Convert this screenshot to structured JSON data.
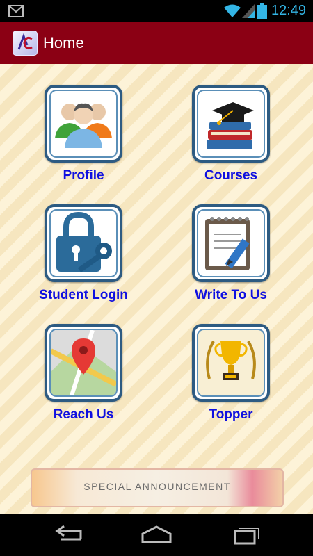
{
  "status_bar": {
    "time": "12:49",
    "icons": [
      "gmail-icon",
      "wifi-icon",
      "signal-icon",
      "battery-icon"
    ],
    "time_color": "#33b5e5"
  },
  "action_bar": {
    "title": "Home",
    "color": "#8b0014"
  },
  "tiles": [
    {
      "label": "Profile",
      "icon": "users-icon"
    },
    {
      "label": "Courses",
      "icon": "graduation-books-icon"
    },
    {
      "label": "Student Login",
      "icon": "lock-key-icon"
    },
    {
      "label": "Write To Us",
      "icon": "notepad-pencil-icon"
    },
    {
      "label": "Reach Us",
      "icon": "map-pin-icon"
    },
    {
      "label": "Topper",
      "icon": "trophy-icon"
    }
  ],
  "announcement": {
    "label": "SPECIAL ANNOUNCEMENT"
  },
  "nav_bar": {
    "buttons": [
      "back-icon",
      "home-icon",
      "recent-apps-icon"
    ]
  },
  "colors": {
    "label_blue": "#1010e0",
    "tile_border": "#2d5b82"
  }
}
